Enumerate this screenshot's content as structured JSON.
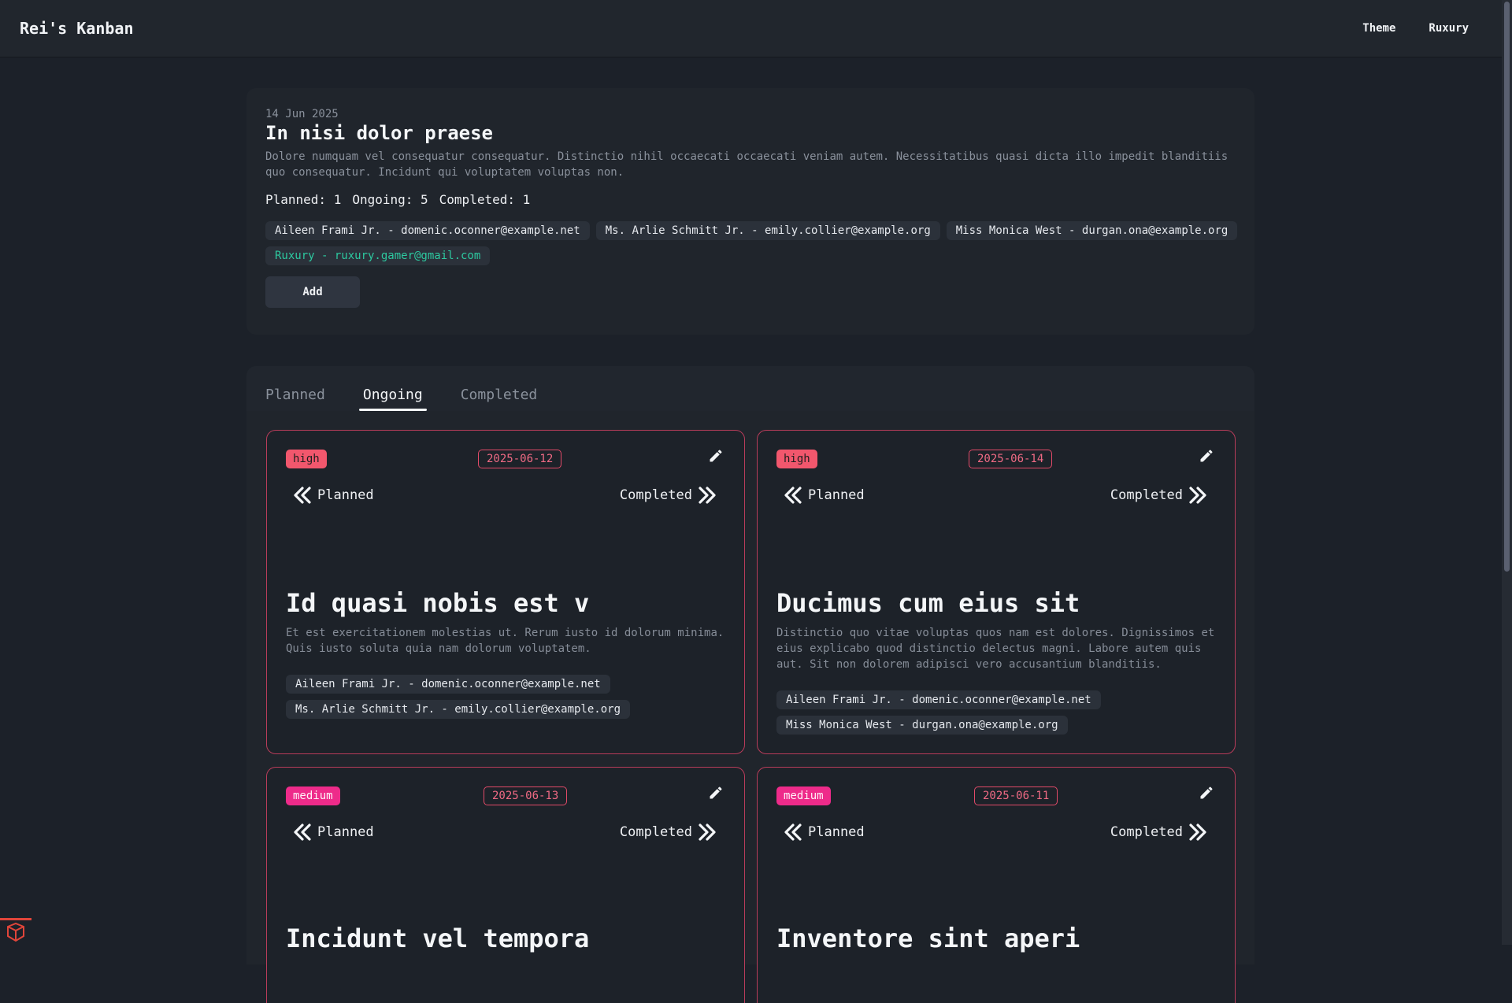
{
  "navbar": {
    "brand": "Rei's Kanban",
    "links": [
      "Theme",
      "Ruxury"
    ]
  },
  "project": {
    "date": "14 Jun 2025",
    "title": "In nisi dolor praese",
    "description": "Dolore numquam vel consequatur consequatur. Distinctio nihil occaecati occaecati veniam autem. Necessitatibus quasi dicta illo impedit blanditiis quo consequatur. Incidunt qui voluptatem voluptas non.",
    "stats": [
      "Planned: 1",
      "Ongoing: 5",
      "Completed: 1"
    ],
    "members": [
      "Aileen Frami Jr. - domenic.oconner@example.net",
      "Ms. Arlie Schmitt Jr. - emily.collier@example.org",
      "Miss Monica West - durgan.ona@example.org",
      "Ruxury - ruxury.gamer@gmail.com"
    ],
    "add_label": "Add"
  },
  "tabs": [
    "Planned",
    "Ongoing",
    "Completed"
  ],
  "active_tab": "Ongoing",
  "tasks": [
    {
      "priority": "high",
      "due": "2025-06-12",
      "prev": "Planned",
      "next": "Completed",
      "title": "Id quasi nobis est v",
      "description": "Et est exercitationem molestias ut. Rerum iusto id dolorum minima. Quis iusto soluta quia nam dolorum voluptatem.",
      "assignees": [
        "Aileen Frami Jr. - domenic.oconner@example.net",
        "Ms. Arlie Schmitt Jr. - emily.collier@example.org"
      ]
    },
    {
      "priority": "high",
      "due": "2025-06-14",
      "prev": "Planned",
      "next": "Completed",
      "title": "Ducimus cum eius sit",
      "description": "Distinctio quo vitae voluptas quos nam est dolores. Dignissimos et eius explicabo quod distinctio delectus magni. Labore autem quis aut. Sit non dolorem adipisci vero accusantium blanditiis.",
      "assignees": [
        "Aileen Frami Jr. - domenic.oconner@example.net",
        "Miss Monica West - durgan.ona@example.org"
      ]
    },
    {
      "priority": "medium",
      "due": "2025-06-13",
      "prev": "Planned",
      "next": "Completed",
      "title": "Incidunt vel tempora",
      "description": "",
      "assignees": []
    },
    {
      "priority": "medium",
      "due": "2025-06-11",
      "prev": "Planned",
      "next": "Completed",
      "title": "Inventore sint aperi",
      "description": "",
      "assignees": []
    }
  ],
  "colors": {
    "high": "#f2576d",
    "medium": "#ee2b8a",
    "accent_member": "#2dc9a0",
    "card_border": "#b83c5a"
  }
}
